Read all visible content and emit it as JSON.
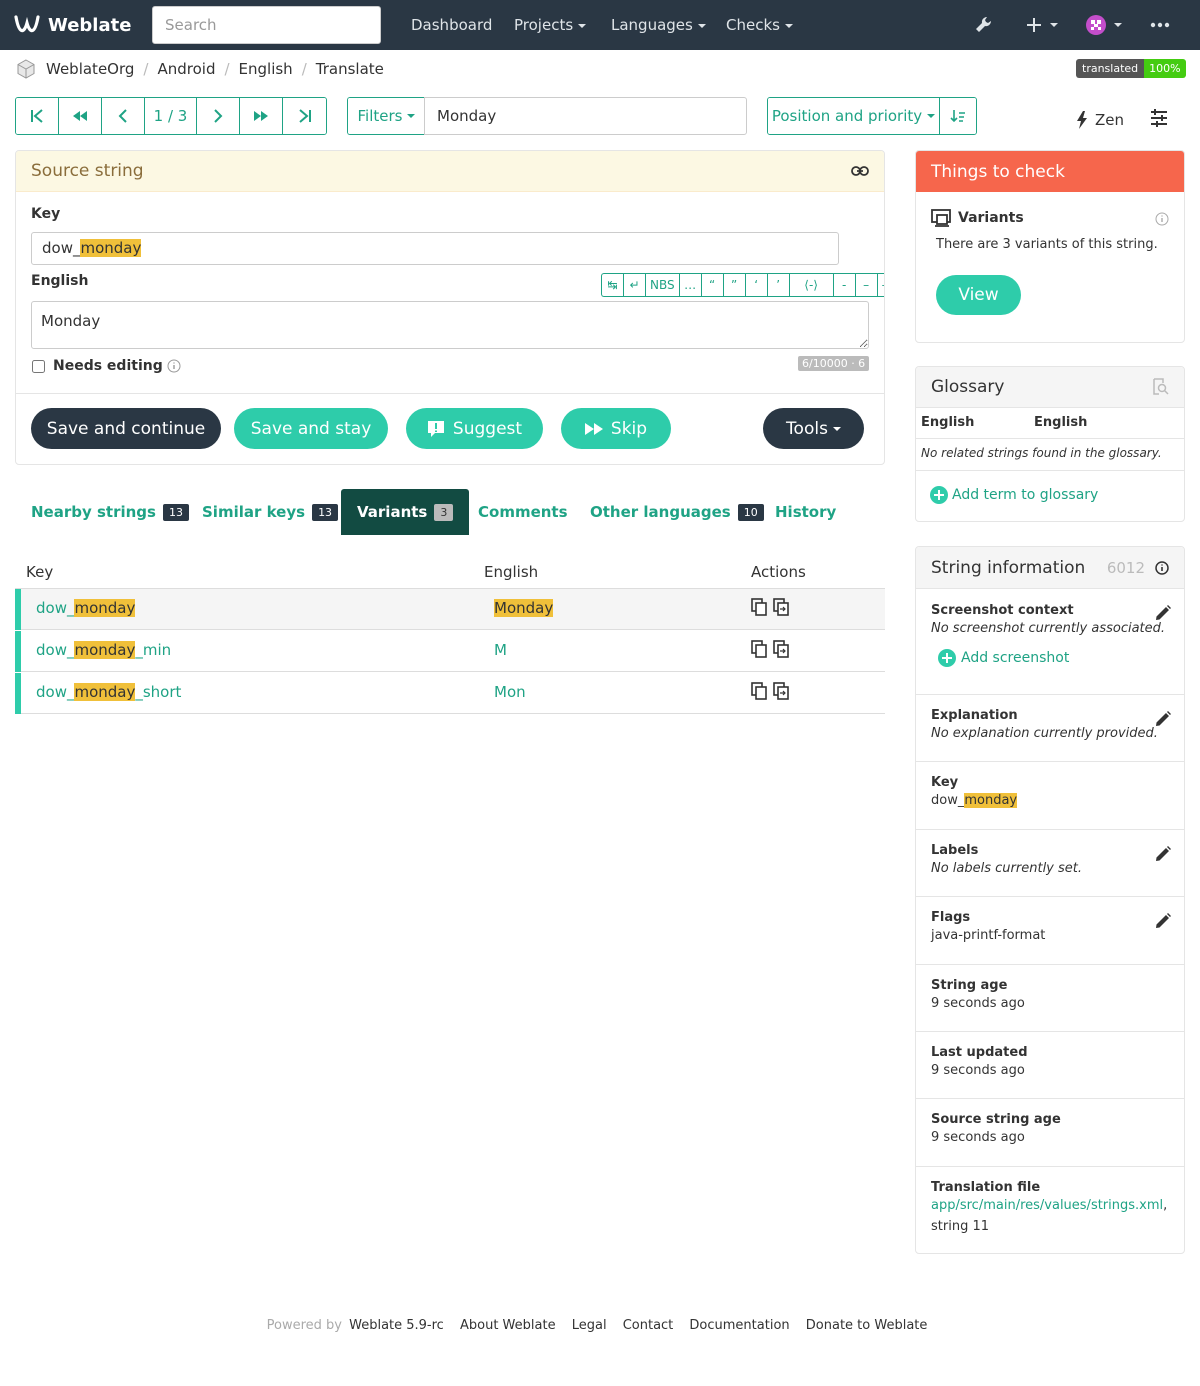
{
  "navbar": {
    "brand": "Weblate",
    "search_placeholder": "Search",
    "items": [
      "Dashboard",
      "Projects",
      "Languages",
      "Checks"
    ]
  },
  "breadcrumb": [
    "WeblateOrg",
    "Android",
    "English",
    "Translate"
  ],
  "status_badge": {
    "label": "translated",
    "value": "100%"
  },
  "pager": {
    "position": "1 / 3"
  },
  "filters": {
    "button": "Filters",
    "query": "Monday"
  },
  "sort": {
    "label": "Position and priority"
  },
  "zen": "Zen",
  "source": {
    "title": "Source string",
    "key_label": "Key",
    "key_pre": "dow_",
    "key_hl": "monday",
    "lang_label": "English",
    "translation": "Monday",
    "chars": [
      "↹",
      "↵",
      "NBS",
      "…",
      "“",
      "”",
      "‘",
      "’",
      "⟨-⟩",
      "-",
      "–",
      "—"
    ],
    "needs_editing": "Needs editing",
    "counter": "6/10000 · 6"
  },
  "buttons": {
    "save_continue": "Save and continue",
    "save_stay": "Save and stay",
    "suggest": "Suggest",
    "skip": "Skip",
    "tools": "Tools"
  },
  "tabs": [
    {
      "label": "Nearby strings",
      "count": "13"
    },
    {
      "label": "Similar keys",
      "count": "13"
    },
    {
      "label": "Variants",
      "count": "3"
    },
    {
      "label": "Comments"
    },
    {
      "label": "Other languages",
      "count": "10"
    },
    {
      "label": "History"
    }
  ],
  "variants": {
    "headers": [
      "Key",
      "English",
      "Actions"
    ],
    "rows": [
      {
        "key_pre": "dow_",
        "key_hl": "monday",
        "key_post": "",
        "english": "Monday"
      },
      {
        "key_pre": "dow_",
        "key_hl": "monday",
        "key_post": "_min",
        "english": "M"
      },
      {
        "key_pre": "dow_",
        "key_hl": "monday",
        "key_post": "_short",
        "english": "Mon"
      }
    ]
  },
  "checks": {
    "title": "Things to check",
    "item_title": "Variants",
    "item_text": "There are 3 variants of this string.",
    "view": "View"
  },
  "glossary": {
    "title": "Glossary",
    "col1": "English",
    "col2": "English",
    "empty": "No related strings found in the glossary.",
    "add": "Add term to glossary"
  },
  "info": {
    "title": "String information",
    "id": "6012",
    "screenshot_title": "Screenshot context",
    "screenshot_value": "No screenshot currently associated.",
    "add_screenshot": "Add screenshot",
    "explanation_title": "Explanation",
    "explanation_value": "No explanation currently provided.",
    "key_title": "Key",
    "key_pre": "dow_",
    "key_hl": "monday",
    "labels_title": "Labels",
    "labels_value": "No labels currently set.",
    "flags_title": "Flags",
    "flags_value": "java-printf-format",
    "string_age_title": "String age",
    "string_age_value": "9 seconds ago",
    "last_updated_title": "Last updated",
    "last_updated_value": "9 seconds ago",
    "source_age_title": "Source string age",
    "source_age_value": "9 seconds ago",
    "file_title": "Translation file",
    "file_link": "app/src/main/res/values/strings.xml",
    "file_comma": ",",
    "file_string": "string 11"
  },
  "footer": {
    "powered": "Powered by",
    "version": "Weblate 5.9-rc",
    "links": [
      "About Weblate",
      "Legal",
      "Contact",
      "Documentation",
      "Donate to Weblate"
    ]
  },
  "colors": {
    "navbar": "#2a3744",
    "accent": "#1fa385",
    "teal_button": "#2eccaa",
    "active_tab": "#124b42",
    "check_header": "#f6664c",
    "highlight": "#f0c03a"
  }
}
